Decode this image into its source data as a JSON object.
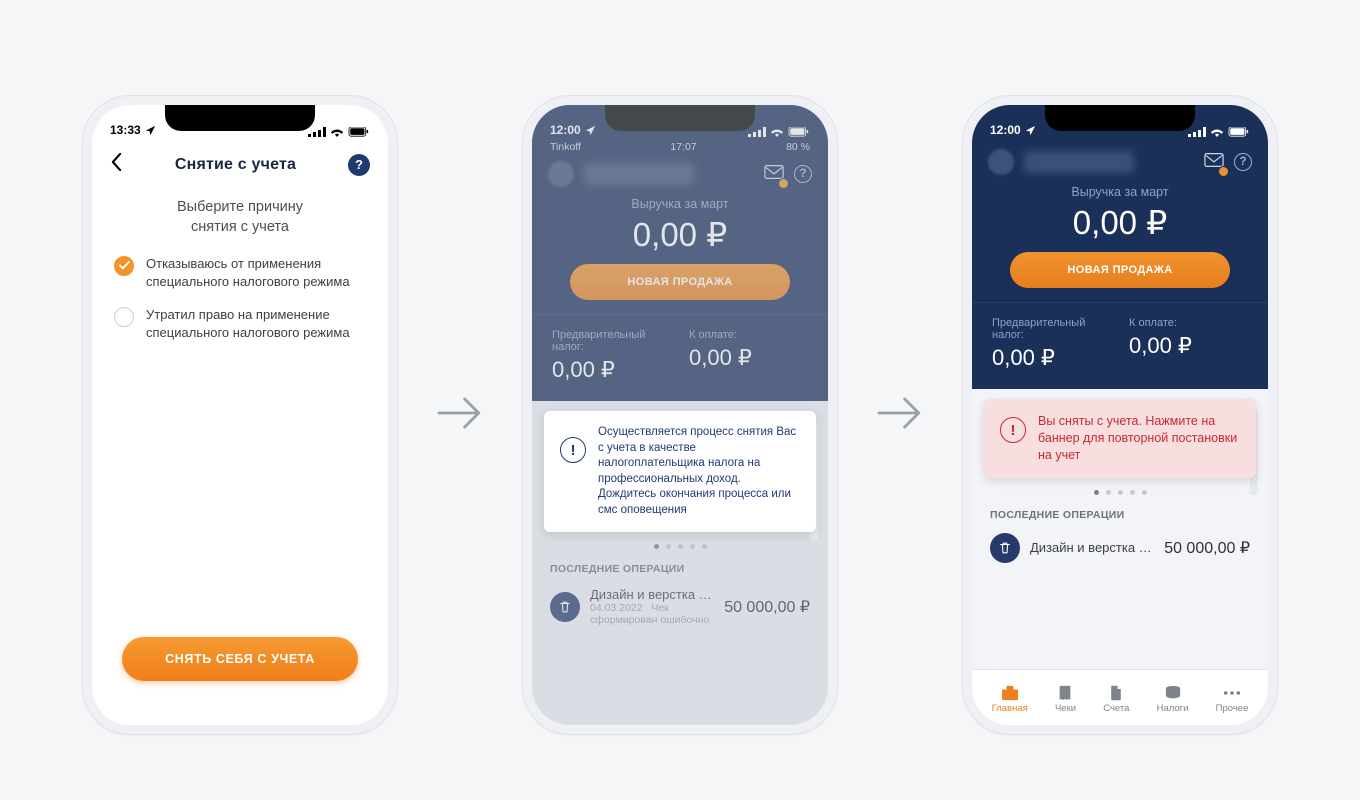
{
  "screen1": {
    "status_time": "13:33",
    "title": "Снятие с учета",
    "subheading": "Выберите причину\nснятия с учета",
    "options": [
      "Отказываюсь от применения специального налогового режима",
      "Утратил право на применение специального налогового режима"
    ],
    "submit_label": "СНЯТЬ СЕБЯ С УЧЕТА"
  },
  "screen2": {
    "status_time": "12:00",
    "carrier": "Tinkoff",
    "carrier_time": "17:07",
    "carrier_batt": "80 %",
    "revenue_label": "Выручка за март",
    "revenue_amount": "0,00 ₽",
    "new_sale_label": "НОВАЯ ПРОДАЖА",
    "tax_prelim_label": "Предварительный налог:",
    "tax_due_label": "К оплате:",
    "tax_prelim_value": "0,00 ₽",
    "tax_due_value": "0,00 ₽",
    "banner_text": "Осуществляется процесс снятия Вас с учета в качестве налогоплательщика налога на профессиональных доход. Дождитесь окончания процесса или смс оповещения",
    "recent_title": "ПОСЛЕДНИЕ ОПЕРАЦИИ",
    "op_name": "Дизайн и верстка сайт…",
    "op_date": "04.03.2022",
    "op_note": "Чек сформирован ошибочно",
    "op_amount": "50 000,00 ₽"
  },
  "screen3": {
    "status_time": "12:00",
    "revenue_label": "Выручка за март",
    "revenue_amount": "0,00 ₽",
    "new_sale_label": "НОВАЯ ПРОДАЖА",
    "tax_prelim_label": "Предварительный налог:",
    "tax_due_label": "К оплате:",
    "tax_prelim_value": "0,00 ₽",
    "tax_due_value": "0,00 ₽",
    "banner_text": "Вы сняты с учета. Нажмите на баннер для повторной постановки на учет",
    "recent_title": "ПОСЛЕДНИЕ ОПЕРАЦИИ",
    "op_name": "Дизайн и верстка сайт…",
    "op_amount": "50 000,00 ₽",
    "tabs": [
      "Главная",
      "Чеки",
      "Счета",
      "Налоги",
      "Прочее"
    ]
  }
}
